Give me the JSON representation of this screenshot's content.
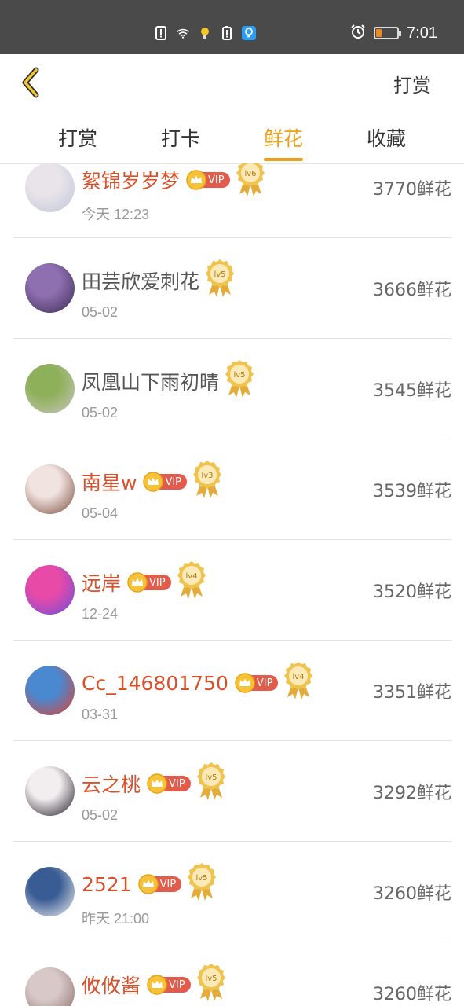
{
  "status_bar": {
    "time": "7:01"
  },
  "header": {
    "back_icon": "chevron-left-icon",
    "action_label": "打赏"
  },
  "tabs": [
    {
      "label": "打赏",
      "active": false
    },
    {
      "label": "打卡",
      "active": false
    },
    {
      "label": "鲜花",
      "active": true
    },
    {
      "label": "收藏",
      "active": false
    }
  ],
  "items": [
    {
      "name": "絮锦岁岁梦",
      "vip": true,
      "vip_label": "VIP",
      "level": "lv6",
      "date": "今天 12:23",
      "amount": "3770鲜花",
      "avatar_colors": [
        "#e9e4ea",
        "#bfc6d8"
      ]
    },
    {
      "name": "田芸欣爱刺花",
      "vip": false,
      "vip_label": "",
      "level": "lv5",
      "date": "05-02",
      "amount": "3666鲜花",
      "avatar_colors": [
        "#8e6fb0",
        "#3b2b52"
      ]
    },
    {
      "name": "凤凰山下雨初晴",
      "vip": false,
      "vip_label": "",
      "level": "lv5",
      "date": "05-02",
      "amount": "3545鲜花",
      "avatar_colors": [
        "#8fb05a",
        "#c9c6c0"
      ]
    },
    {
      "name": "南星w",
      "vip": true,
      "vip_label": "VIP",
      "level": "lv3",
      "date": "05-04",
      "amount": "3539鲜花",
      "avatar_colors": [
        "#f1e3e0",
        "#7a4a3a"
      ]
    },
    {
      "name": "远岸",
      "vip": true,
      "vip_label": "VIP",
      "level": "lv4",
      "date": "12-24",
      "amount": "3520鲜花",
      "avatar_colors": [
        "#e84aa8",
        "#6a4fd8"
      ]
    },
    {
      "name": "Cc_146801750",
      "vip": true,
      "vip_label": "VIP",
      "level": "lv4",
      "date": "03-31",
      "amount": "3351鲜花",
      "avatar_colors": [
        "#4a88d0",
        "#e04030"
      ]
    },
    {
      "name": "云之桃",
      "vip": true,
      "vip_label": "VIP",
      "level": "lv5",
      "date": "05-02",
      "amount": "3292鲜花",
      "avatar_colors": [
        "#f2eef0",
        "#1e1a22"
      ]
    },
    {
      "name": "2521",
      "vip": true,
      "vip_label": "VIP",
      "level": "lv5",
      "date": "昨天 21:00",
      "amount": "3260鲜花",
      "avatar_colors": [
        "#3a5c94",
        "#f2f2f2"
      ]
    },
    {
      "name": "攸攸酱",
      "vip": true,
      "vip_label": "VIP",
      "level": "lv5",
      "date": "",
      "amount": "3260鲜花",
      "avatar_colors": [
        "#d8c8c8",
        "#8a6a6a"
      ]
    }
  ]
}
